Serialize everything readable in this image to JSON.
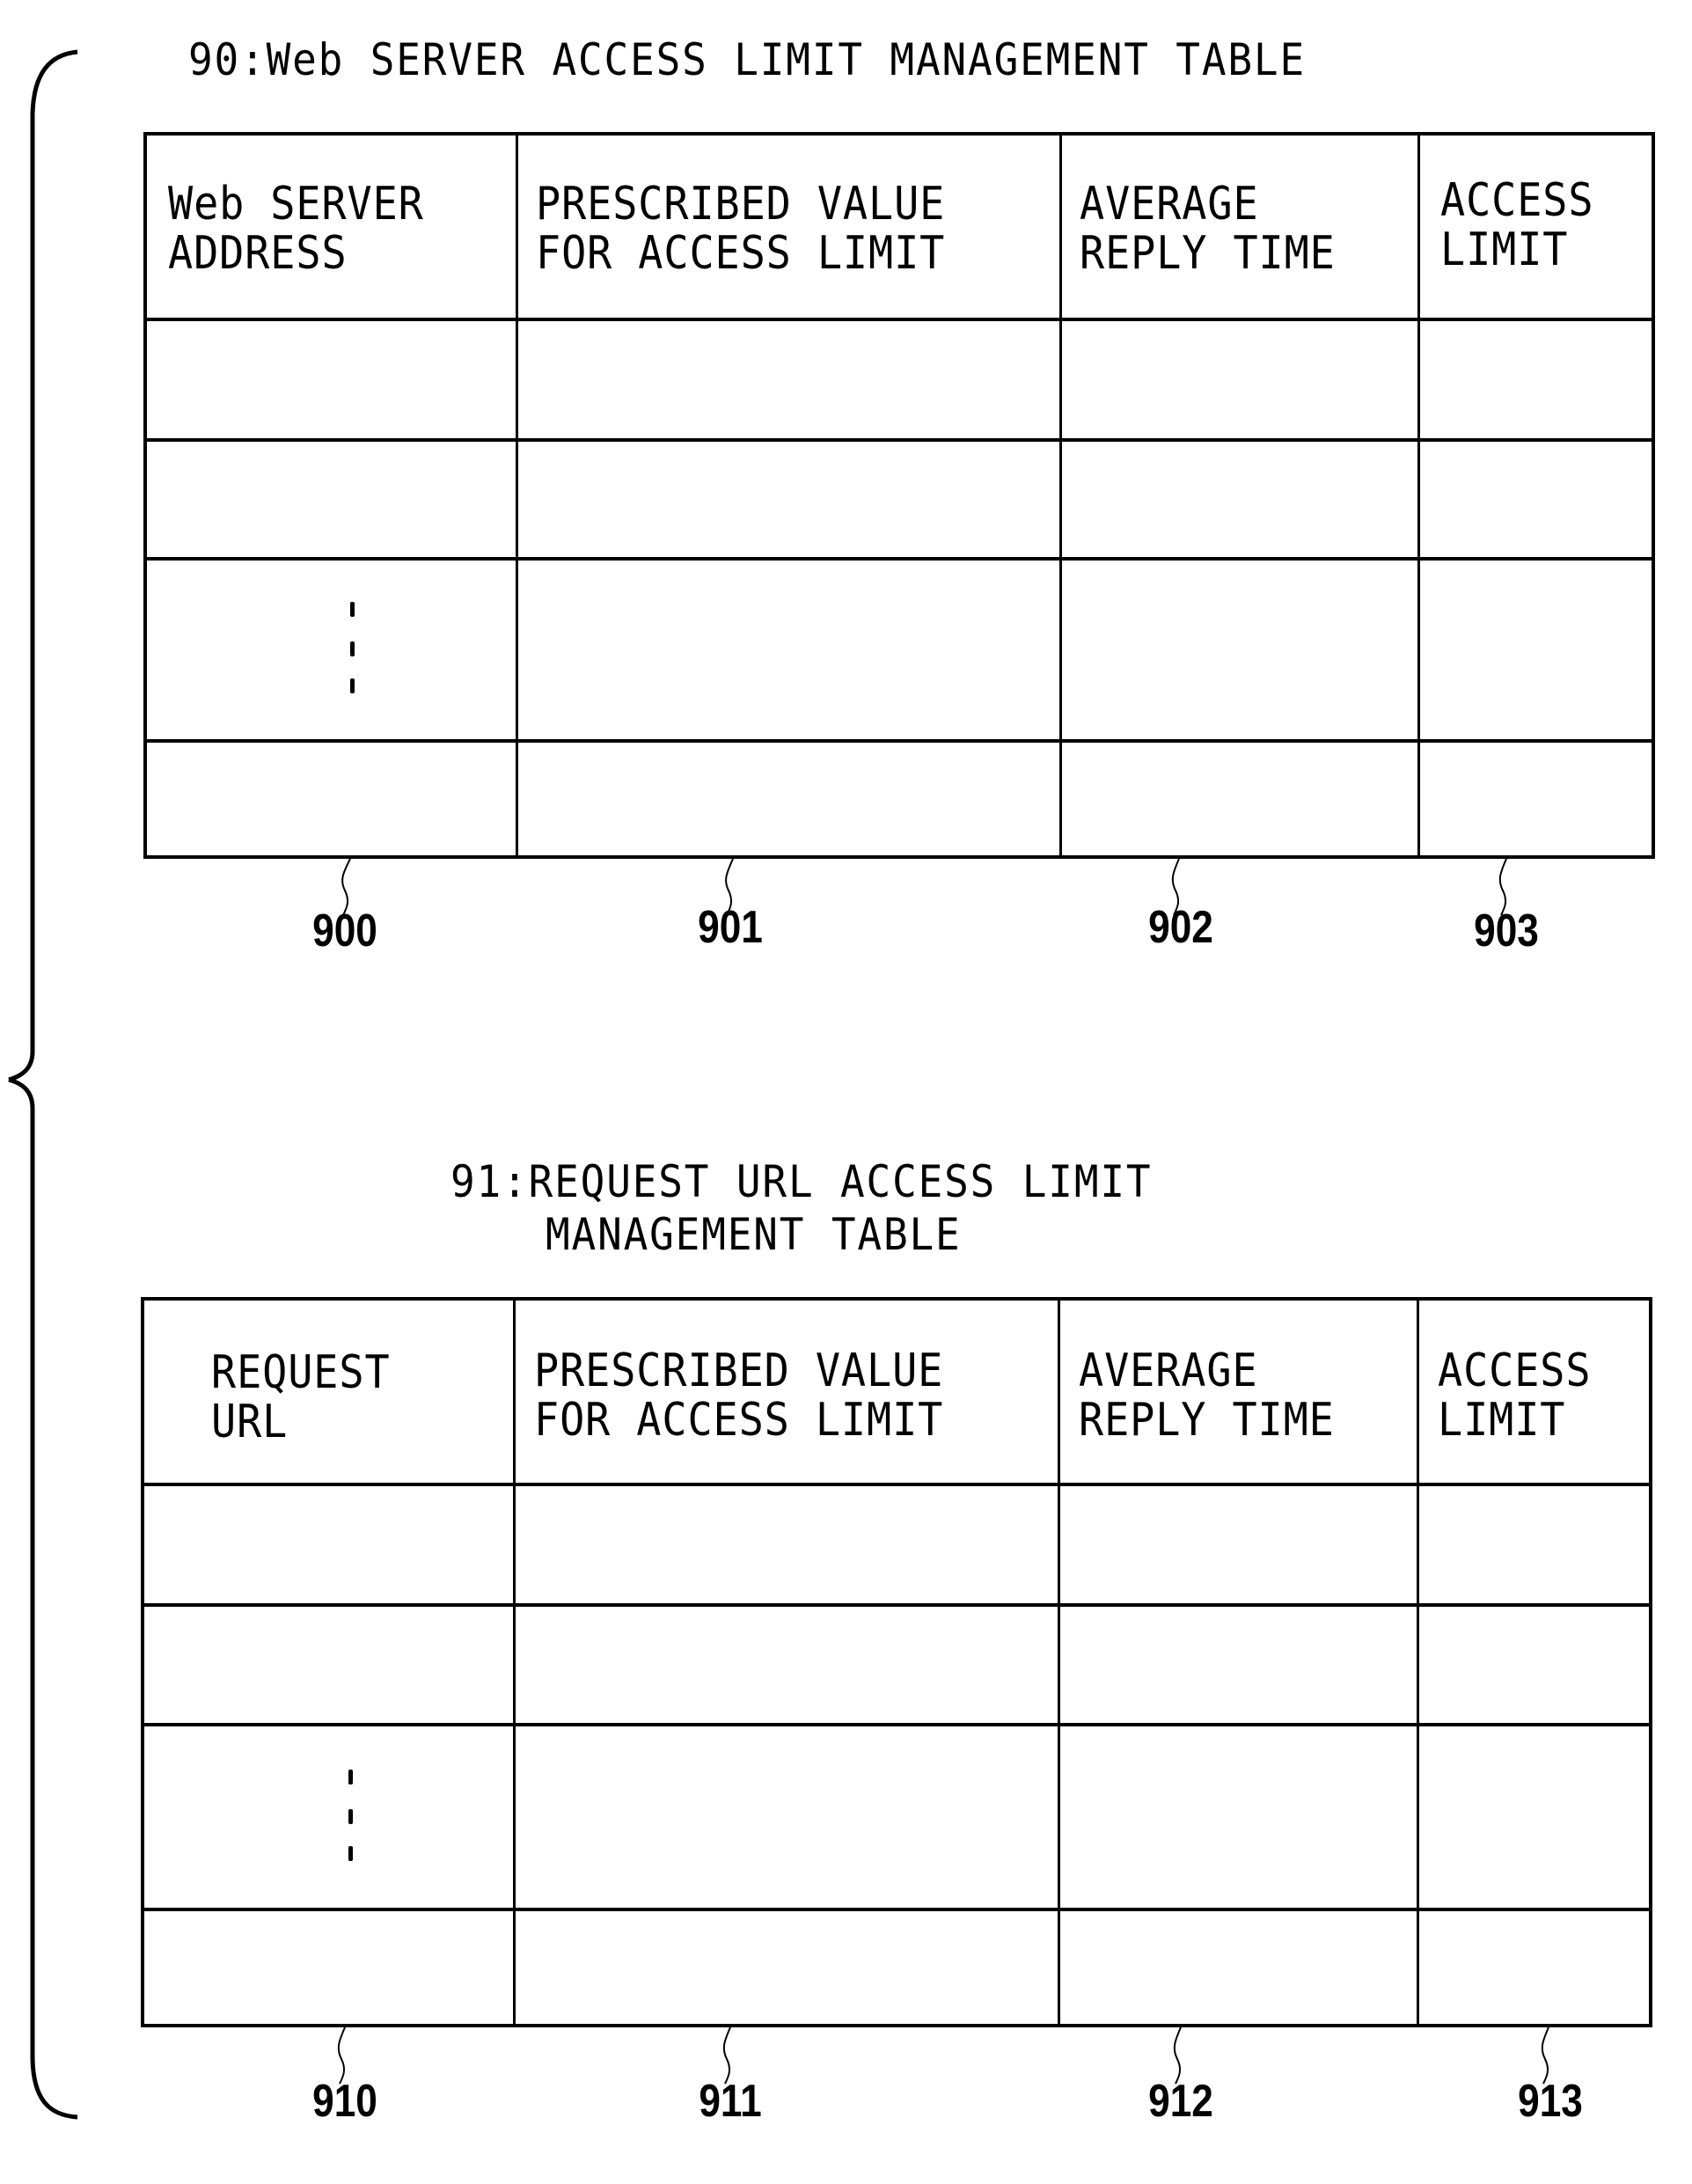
{
  "figure": {
    "tables": [
      {
        "id": "90",
        "title_lines": [
          "90:Web SERVER ACCESS LIMIT MANAGEMENT TABLE"
        ],
        "columns": [
          {
            "ref": "900",
            "header_lines": [
              "Web SERVER",
              "ADDRESS"
            ]
          },
          {
            "ref": "901",
            "header_lines": [
              "PRESCRIBED VALUE",
              "FOR ACCESS LIMIT"
            ]
          },
          {
            "ref": "902",
            "header_lines": [
              "AVERAGE",
              "REPLY TIME"
            ]
          },
          {
            "ref": "903",
            "header_lines": [
              "ACCESS",
              "LIMIT"
            ]
          }
        ],
        "rows": [
          [
            "",
            "",
            "",
            ""
          ],
          [
            "",
            "",
            "",
            ""
          ],
          [
            "ellipsis",
            "",
            "",
            ""
          ],
          [
            "",
            "",
            "",
            ""
          ]
        ]
      },
      {
        "id": "91",
        "title_lines": [
          "91:REQUEST URL ACCESS LIMIT",
          "MANAGEMENT TABLE"
        ],
        "columns": [
          {
            "ref": "910",
            "header_lines": [
              "REQUEST",
              "URL"
            ]
          },
          {
            "ref": "911",
            "header_lines": [
              "PRESCRIBED VALUE",
              "FOR ACCESS LIMIT"
            ]
          },
          {
            "ref": "912",
            "header_lines": [
              "AVERAGE",
              "REPLY TIME"
            ]
          },
          {
            "ref": "913",
            "header_lines": [
              "ACCESS",
              "LIMIT"
            ]
          }
        ],
        "rows": [
          [
            "",
            "",
            "",
            ""
          ],
          [
            "",
            "",
            "",
            ""
          ],
          [
            "ellipsis",
            "",
            "",
            ""
          ],
          [
            "",
            "",
            "",
            ""
          ]
        ]
      }
    ],
    "brace": "left-curly-brace-grouping-both-tables",
    "colors": {
      "ink": "#000000",
      "paper": "#ffffff"
    }
  }
}
